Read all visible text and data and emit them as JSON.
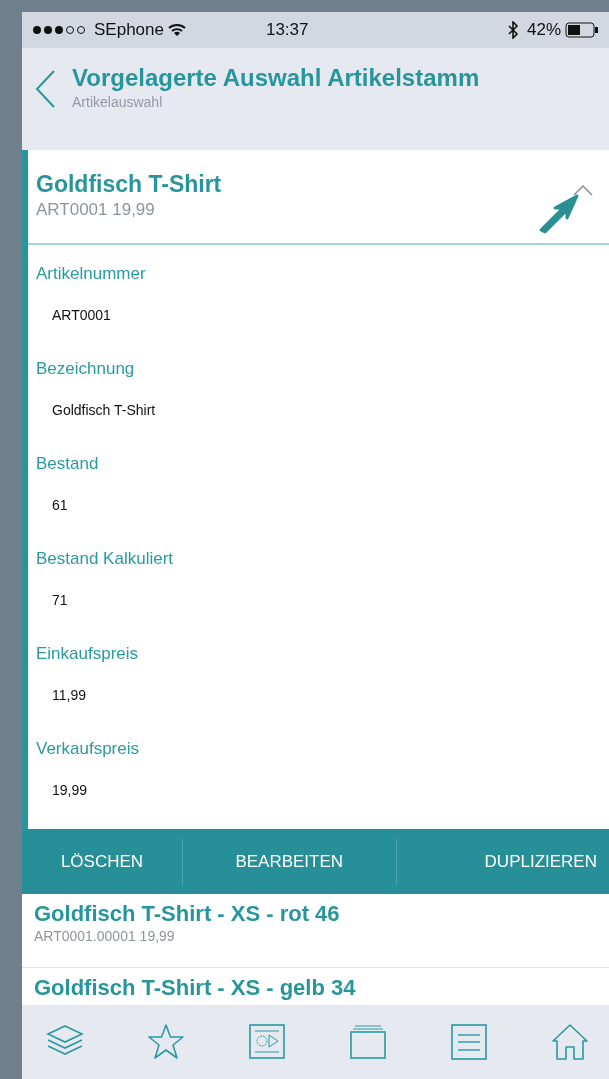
{
  "status_bar": {
    "carrier": "SEphone",
    "time": "13:37",
    "battery": "42%"
  },
  "header": {
    "title": "Vorgelagerte Auswahl Artikelstamm",
    "subtitle": "Artikelauswahl"
  },
  "article": {
    "title": "Goldfisch T-Shirt",
    "subtitle": "ART0001 19,99",
    "expanded": true,
    "fields": [
      {
        "label": "Artikelnummer",
        "value": "ART0001"
      },
      {
        "label": "Bezeichnung",
        "value": "Goldfisch T-Shirt"
      },
      {
        "label": "Bestand",
        "value": "61"
      },
      {
        "label": "Bestand Kalkuliert",
        "value": "71"
      },
      {
        "label": "Einkaufspreis",
        "value": "11,99"
      },
      {
        "label": "Verkaufspreis",
        "value": "19,99"
      }
    ],
    "actions": [
      "LÖSCHEN",
      "BEARBEITEN",
      "DUPLIZIEREN"
    ]
  },
  "variants": [
    {
      "title": "Goldfisch T-Shirt - XS - rot 46",
      "subtitle": "ART0001.00001 19,99"
    },
    {
      "title": "Goldfisch T-Shirt - XS - gelb 34"
    }
  ],
  "tab_bar": [
    {
      "kind": "layers"
    },
    {
      "kind": "star"
    },
    {
      "kind": "media"
    },
    {
      "kind": "folder"
    },
    {
      "kind": "list"
    },
    {
      "kind": "home"
    }
  ]
}
